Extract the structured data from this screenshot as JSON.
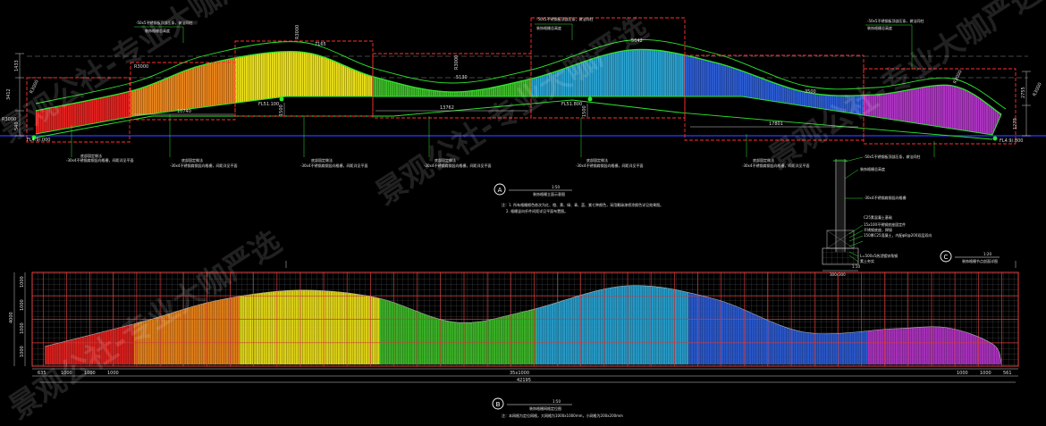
{
  "elevation_a": {
    "bands": [
      {
        "name": "red",
        "color": "#e8221f"
      },
      {
        "name": "orange",
        "color": "#f0881c"
      },
      {
        "name": "yellow",
        "color": "#efe31a"
      },
      {
        "name": "green",
        "color": "#3fbf2a"
      },
      {
        "name": "cyan",
        "color": "#2aa6d6"
      },
      {
        "name": "blue",
        "color": "#2d5ed8"
      },
      {
        "name": "purple",
        "color": "#b335c9"
      }
    ],
    "top_notes": [
      "-50x5不锈钢板顶部压条，做法同柱",
      "-50x5不锈钢板顶部压条，做法同柱",
      "-50x5不锈钢板顶部压条，做法同柱"
    ],
    "sub_notes": [
      "装饰格栅总高度",
      "装饰格栅总高度",
      "装饰格栅总高度"
    ],
    "bottom_notes": [
      "-30x4不锈钢扁钢竖向格栅，间距详见平面",
      "-30x4不锈钢扁钢竖向格栅，间距详见平面",
      "-30x4不锈钢扁钢竖向格栅，间距详见平面",
      "-30x4不锈钢扁钢竖向格栅，间距详见平面",
      "-30x4不锈钢扁钢竖向格栅，间距详见平面",
      "-30x4不锈钢扁钢竖向格栅，间距详见平面"
    ],
    "bottom_sub_notes": [
      "底部固定做法",
      "底部固定做法",
      "底部固定做法",
      "底部固定做法",
      "底部固定做法",
      "底部固定做法"
    ],
    "radii": [
      "R3000",
      "R3000",
      "R3000",
      "R3000",
      "R3000",
      "R3000"
    ],
    "dims_h": [
      "10740",
      "13762",
      "17801"
    ],
    "dims_arc": [
      "7165",
      "5642",
      "5130",
      "3500"
    ],
    "dims_v_left": [
      "1433",
      "3412",
      "540"
    ],
    "dims_v_right": [
      "2755",
      "1279"
    ],
    "dims_v_mid": [
      "1500",
      "1500"
    ],
    "levels": [
      "FL4.9/.000",
      "FL51.100",
      "FL51.800",
      "FL4.9/.800",
      "FL4.9/.800"
    ],
    "label_letter": "A",
    "label_scale": "1:50",
    "label_title": "装饰格栅立面示意图",
    "label_notes": [
      "注：1. 所有格栅颜色依次为红、橙、黄、绿、青、蓝、紫七种颜色，采用氟碳漆喷涂颜色详见效果图。",
      "2. 格栅竖向杆件间距详见平面布置图。"
    ]
  },
  "section_c": {
    "notes": [
      "-50x5不锈钢板顶部压条，做法同柱",
      "装饰格栅总高度",
      "-30x4不锈钢扁钢竖向格栅",
      "C25素混凝土基础",
      "15x100不锈钢底座固定件",
      "不锈钢底座，焊接",
      "150厚C25混凝土，内配φ8@200双层双向",
      "L=500x5热浸镀锌角钢",
      "素土夯实",
      "300x300"
    ],
    "scale_text": "1:10",
    "label_letter": "C",
    "label_scale": "1:20",
    "label_title": "装饰格栅节点剖面详图"
  },
  "elevation_b": {
    "top_dims": [
      "1000",
      "1000",
      "1000",
      "1000"
    ],
    "side_dims": [
      "4000",
      "1000",
      "1000",
      "1000",
      "1000"
    ],
    "bottom_row": [
      "635",
      "1000",
      "1000",
      "1000",
      "35x1000",
      "1000",
      "1000",
      "561"
    ],
    "total": "42195",
    "label_letter": "B",
    "label_scale": "1:50",
    "label_title": "装饰格栅网格定位图",
    "label_note": "注：本网格为定位网格，大网格为1000x1000mm，小网格为200x200mm"
  },
  "watermark": {
    "text_1": "景观公社-专业大咖严选",
    "text_2": "景观公社-专业大咖严选",
    "text_3": "景观公社-专业大咖严选",
    "text_4": "景观公社-专业大咖严选"
  },
  "colors": {
    "background": "#000000",
    "outline": "#ff3030",
    "curve": "#2ee62e",
    "baseline": "#2f3cff",
    "dimension": "#cfcfcf",
    "grid_major": "#d23a3a"
  }
}
